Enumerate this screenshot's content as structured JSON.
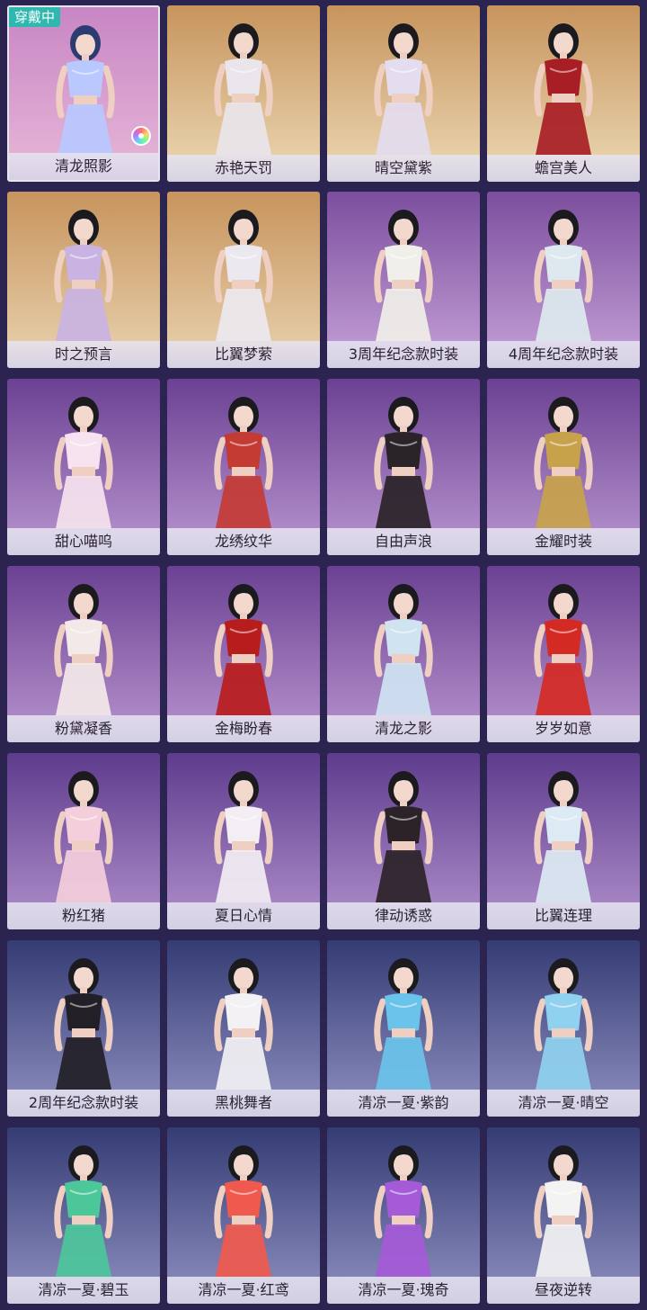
{
  "badge": "穿戴中",
  "outfits": [
    {
      "name": "清龙照影",
      "bg": [
        "#c886c4",
        "#e7b8d8"
      ],
      "color": "#b9c8ff",
      "hair": "#2c3c70",
      "equipped": true
    },
    {
      "name": "赤艳天罚",
      "bg": [
        "#c7945d",
        "#ecd9b5"
      ],
      "color": "#e9e5ea",
      "hair": "#1b1b1f",
      "equipped": false
    },
    {
      "name": "晴空黛紫",
      "bg": [
        "#c7945d",
        "#ecd9b5"
      ],
      "color": "#e4dcef",
      "hair": "#1b1b1f",
      "equipped": false
    },
    {
      "name": "蟾宫美人",
      "bg": [
        "#c7945d",
        "#ecd9b5"
      ],
      "color": "#a81e25",
      "hair": "#1b1b1f",
      "equipped": false
    },
    {
      "name": "时之预言",
      "bg": [
        "#c7945d",
        "#e9d3b0"
      ],
      "color": "#c9b3e3",
      "hair": "#1b1b1f",
      "equipped": false
    },
    {
      "name": "比翼梦萦",
      "bg": [
        "#c7945d",
        "#e9d3b0"
      ],
      "color": "#ece8ef",
      "hair": "#1b1b1f",
      "equipped": false
    },
    {
      "name": "3周年纪念款时装",
      "bg": [
        "#7c4e9e",
        "#c6a2d8"
      ],
      "color": "#f1efe9",
      "hair": "#1b1b1f",
      "equipped": false
    },
    {
      "name": "4周年纪念款时装",
      "bg": [
        "#7c4e9e",
        "#c6a2d8"
      ],
      "color": "#dde9ef",
      "hair": "#1b1b1f",
      "equipped": false
    },
    {
      "name": "甜心喵呜",
      "bg": [
        "#6b4193",
        "#b996d0"
      ],
      "color": "#f6e3ef",
      "hair": "#1b1b1f",
      "equipped": false
    },
    {
      "name": "龙绣纹华",
      "bg": [
        "#6b4193",
        "#b996d0"
      ],
      "color": "#c43b34",
      "hair": "#1b1b1f",
      "equipped": false
    },
    {
      "name": "自由声浪",
      "bg": [
        "#6b4193",
        "#b996d0"
      ],
      "color": "#2a2328",
      "hair": "#1b1b1f",
      "equipped": false
    },
    {
      "name": "金耀时装",
      "bg": [
        "#6b4193",
        "#b996d0"
      ],
      "color": "#c8a24a",
      "hair": "#1b1b1f",
      "equipped": false
    },
    {
      "name": "粉黛凝香",
      "bg": [
        "#6b4193",
        "#b894ce"
      ],
      "color": "#f3e9e9",
      "hair": "#1b1b1f",
      "equipped": false
    },
    {
      "name": "金梅盼春",
      "bg": [
        "#6b4193",
        "#b894ce"
      ],
      "color": "#b81d1d",
      "hair": "#1b1b1f",
      "equipped": false
    },
    {
      "name": "清龙之影",
      "bg": [
        "#6b4193",
        "#b894ce"
      ],
      "color": "#cfe3f1",
      "hair": "#1b1b1f",
      "equipped": false
    },
    {
      "name": "岁岁如意",
      "bg": [
        "#6b4193",
        "#b894ce"
      ],
      "color": "#d42a24",
      "hair": "#1b1b1f",
      "equipped": false
    },
    {
      "name": "粉红猪",
      "bg": [
        "#5e3c8d",
        "#b190cc"
      ],
      "color": "#f4cedb",
      "hair": "#1b1b1f",
      "equipped": false
    },
    {
      "name": "夏日心情",
      "bg": [
        "#5e3c8d",
        "#b190cc"
      ],
      "color": "#f2eef3",
      "hair": "#1b1b1f",
      "equipped": false
    },
    {
      "name": "律动诱惑",
      "bg": [
        "#5e3c8d",
        "#b190cc"
      ],
      "color": "#2b2328",
      "hair": "#1b1b1f",
      "equipped": false
    },
    {
      "name": "比翼连理",
      "bg": [
        "#5e3c8d",
        "#b190cc"
      ],
      "color": "#dceaf3",
      "hair": "#1b1b1f",
      "equipped": false
    },
    {
      "name": "2周年纪念款时装",
      "bg": [
        "#343c74",
        "#8f90c0"
      ],
      "color": "#221f26",
      "hair": "#1b1b1f",
      "equipped": false
    },
    {
      "name": "黑桃舞者",
      "bg": [
        "#343c74",
        "#8f90c0"
      ],
      "color": "#f3f1f4",
      "hair": "#1b1b1f",
      "equipped": false
    },
    {
      "name": "清凉一夏·紫韵",
      "bg": [
        "#343c74",
        "#8f90c0"
      ],
      "color": "#6ac3ea",
      "hair": "#1b1b1f",
      "equipped": false
    },
    {
      "name": "清凉一夏·晴空",
      "bg": [
        "#343c74",
        "#8f90c0"
      ],
      "color": "#8fd1ef",
      "hair": "#1b1b1f",
      "equipped": false
    },
    {
      "name": "清凉一夏·碧玉",
      "bg": [
        "#343c74",
        "#8f90c0"
      ],
      "color": "#4cc79a",
      "hair": "#1b1b1f",
      "equipped": false
    },
    {
      "name": "清凉一夏·红鸢",
      "bg": [
        "#343c74",
        "#8f90c0"
      ],
      "color": "#f05a4e",
      "hair": "#1b1b1f",
      "equipped": false
    },
    {
      "name": "清凉一夏·瑰奇",
      "bg": [
        "#343c74",
        "#8f90c0"
      ],
      "color": "#a55ad8",
      "hair": "#1b1b1f",
      "equipped": false
    },
    {
      "name": "昼夜逆转",
      "bg": [
        "#343c74",
        "#8f90c0"
      ],
      "color": "#f3f3f3",
      "hair": "#1b1b1f",
      "equipped": false
    }
  ]
}
